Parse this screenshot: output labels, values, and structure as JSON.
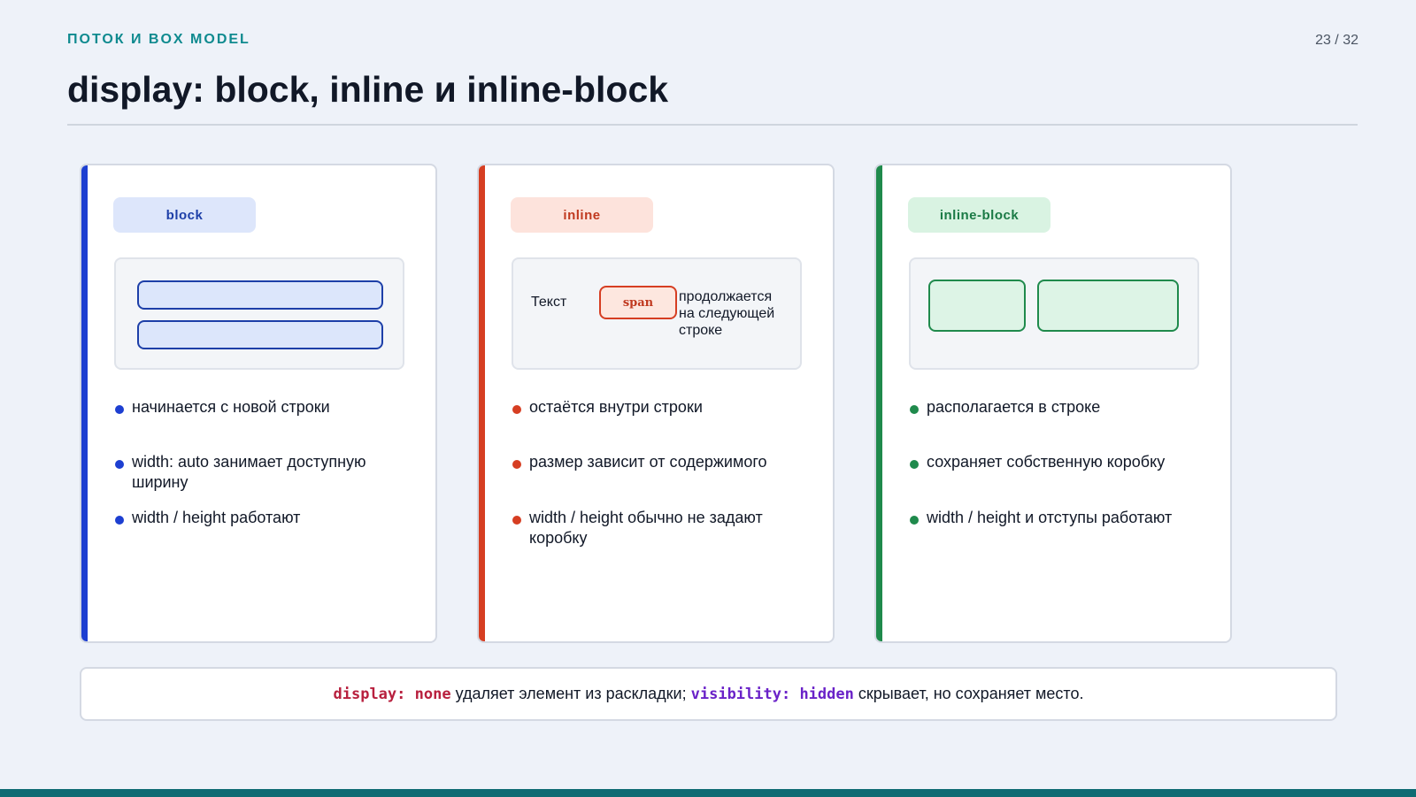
{
  "header": {
    "kicker": "ПОТОК И BOX MODEL",
    "page_number": "23 / 32",
    "title": "display: block, inline и inline-block"
  },
  "colors": {
    "accent_teal": "#0f8a8f",
    "block_blue": "#1d3fd1",
    "inline_red": "#d63e22",
    "inline_block_green": "#1f8a4c"
  },
  "cards": [
    {
      "tag": "block",
      "bullets": [
        "начинается с новой строки",
        "width: auto занимает доступную ширину",
        "width / height работают"
      ]
    },
    {
      "tag": "inline",
      "demo": {
        "text_before": "Текст",
        "span_label": "span",
        "text_after": "продолжается на следующей строке"
      },
      "bullets": [
        "остаётся внутри строки",
        "размер зависит от содержимого",
        "width / height обычно не задают коробку"
      ]
    },
    {
      "tag": "inline-block",
      "bullets": [
        "располагается в строке",
        "сохраняет собственную коробку",
        "width / height и отступы работают"
      ]
    }
  ],
  "note": {
    "code1": "display: none",
    "text1": " удаляет элемент из раскладки; ",
    "code2": "visibility: hidden",
    "text2": " скрывает, но сохраняет место."
  }
}
